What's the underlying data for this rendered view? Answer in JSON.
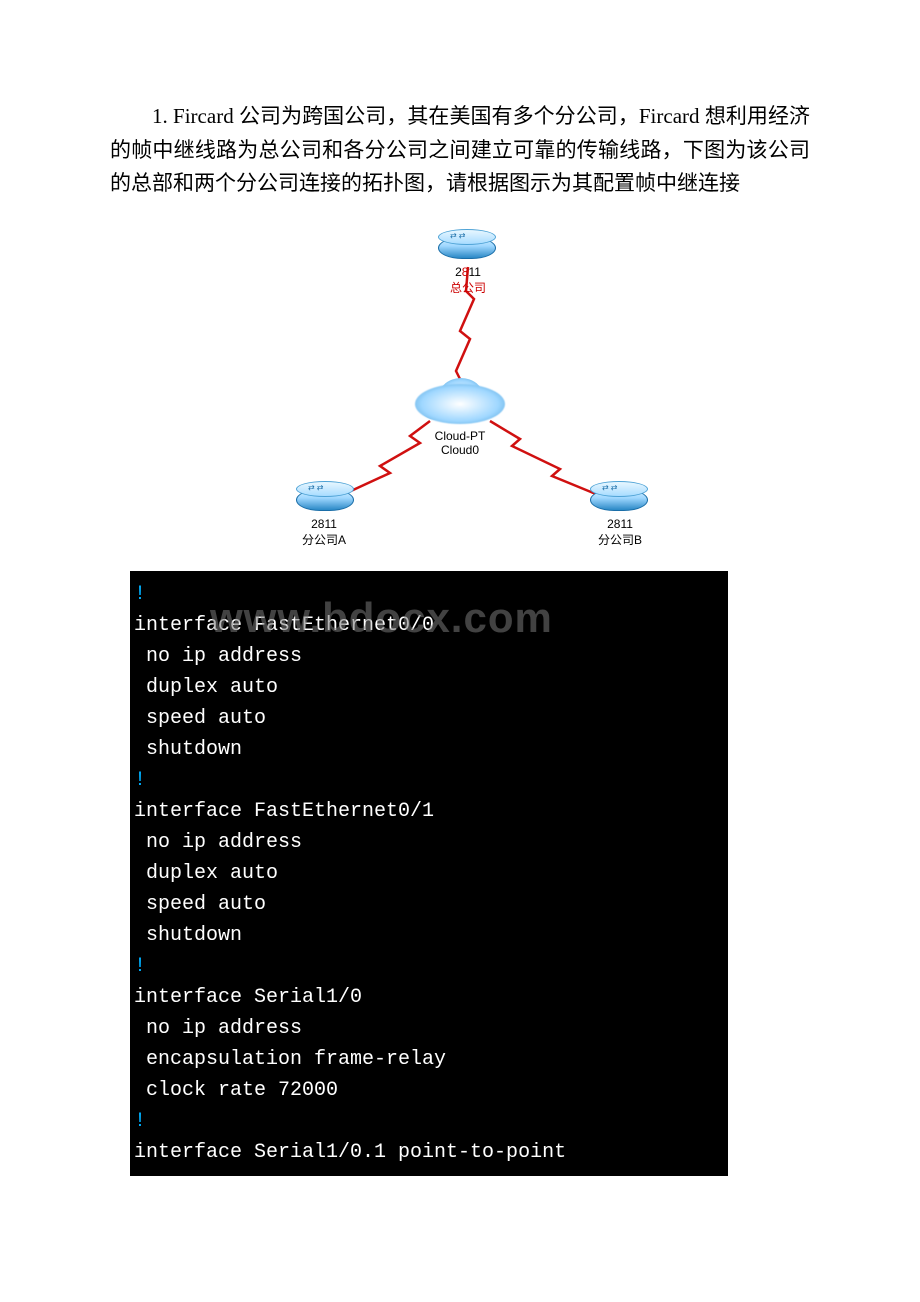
{
  "paragraph": "1. Fircard 公司为跨国公司，其在美国有多个分公司，Fircard 想利用经济的帧中继线路为总公司和各分公司之间建立可靠的传输线路，下图为该公司的总部和两个分公司连接的拓扑图，请根据图示为其配置帧中继连接",
  "topology": {
    "top_router": {
      "model": "2811",
      "name": "总公司"
    },
    "cloud": {
      "line1": "Cloud-PT",
      "line2": "Cloud0"
    },
    "left_router": {
      "model": "2811",
      "name": "分公司A"
    },
    "right_router": {
      "model": "2811",
      "name": "分公司B"
    }
  },
  "terminal_lines": [
    {
      "t": "!",
      "bang": true
    },
    {
      "t": "interface FastEthernet0/0"
    },
    {
      "t": " no ip address"
    },
    {
      "t": " duplex auto"
    },
    {
      "t": " speed auto"
    },
    {
      "t": " shutdown"
    },
    {
      "t": "!",
      "bang": true
    },
    {
      "t": "interface FastEthernet0/1"
    },
    {
      "t": " no ip address"
    },
    {
      "t": " duplex auto"
    },
    {
      "t": " speed auto"
    },
    {
      "t": " shutdown"
    },
    {
      "t": "!",
      "bang": true
    },
    {
      "t": "interface Serial1/0"
    },
    {
      "t": " no ip address"
    },
    {
      "t": " encapsulation frame-relay"
    },
    {
      "t": " clock rate 72000"
    },
    {
      "t": "!",
      "bang": true
    },
    {
      "t": "interface Serial1/0.1 point-to-point"
    }
  ],
  "watermark": "www.bdocx.com"
}
